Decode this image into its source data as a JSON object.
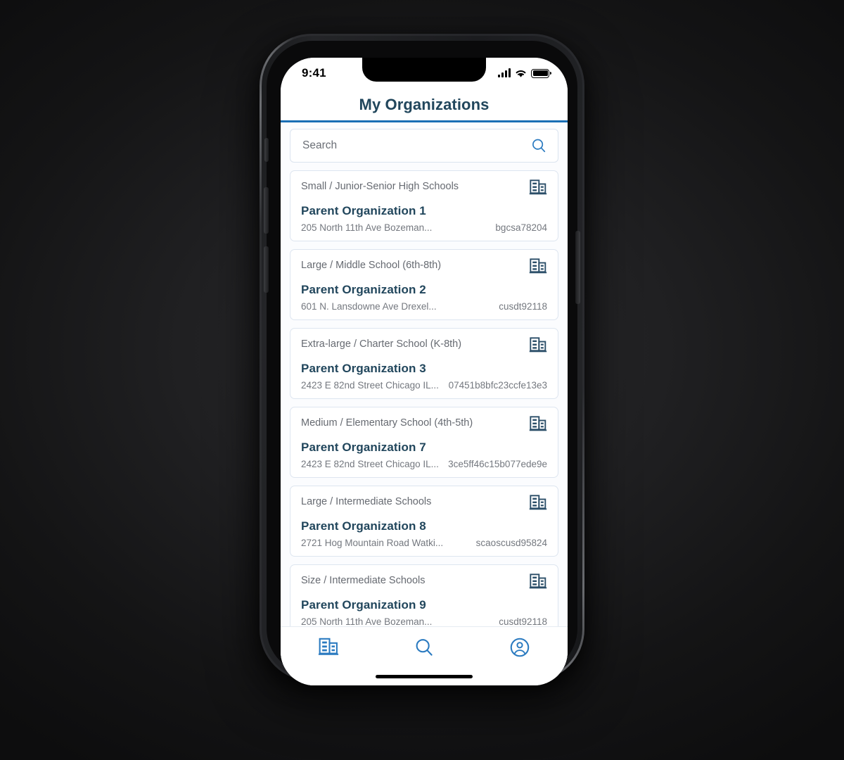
{
  "status_bar": {
    "time": "9:41",
    "signal_icon": "cellular-signal-icon",
    "wifi_icon": "wifi-icon",
    "battery_icon": "battery-full-icon"
  },
  "header": {
    "title": "My Organizations",
    "accent_color": "#1a6fb5",
    "title_color": "#21465c"
  },
  "search": {
    "placeholder": "Search",
    "value": "",
    "icon": "search-icon"
  },
  "organizations": [
    {
      "category": "Small / Junior-Senior High Schools",
      "name": "Parent Organization 1",
      "address": "205 North 11th Ave Bozeman...",
      "code": "bgcsa78204",
      "icon": "building-icon"
    },
    {
      "category": "Large / Middle School (6th-8th)",
      "name": "Parent Organization 2",
      "address": "601 N. Lansdowne Ave Drexel...",
      "code": "cusdt92118",
      "icon": "building-icon"
    },
    {
      "category": "Extra-large / Charter School (K-8th)",
      "name": "Parent Organization 3",
      "address": "2423 E 82nd Street Chicago IL...",
      "code": "07451b8bfc23ccfe13e3",
      "icon": "building-icon"
    },
    {
      "category": "Medium / Elementary School (4th-5th)",
      "name": "Parent Organization 7",
      "address": "2423 E 82nd Street Chicago IL...",
      "code": "3ce5ff46c15b077ede9e",
      "icon": "building-icon"
    },
    {
      "category": "Large / Intermediate Schools",
      "name": "Parent Organization 8",
      "address": "2721 Hog Mountain Road Watki...",
      "code": "scaoscusd95824",
      "icon": "building-icon"
    },
    {
      "category": "Size / Intermediate Schools",
      "name": "Parent Organization 9",
      "address": "205 North 11th Ave Bozeman...",
      "code": "cusdt92118",
      "icon": "building-icon"
    }
  ],
  "tab_bar": {
    "items": [
      {
        "name": "organizations",
        "icon": "building-icon",
        "active": true
      },
      {
        "name": "search",
        "icon": "search-icon",
        "active": false
      },
      {
        "name": "profile",
        "icon": "user-circle-icon",
        "active": false
      }
    ],
    "icon_color": "#2a7ac0"
  }
}
